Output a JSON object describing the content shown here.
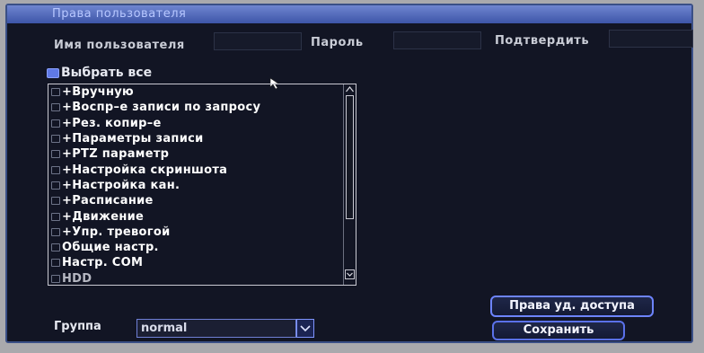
{
  "window": {
    "title": "Права пользователя"
  },
  "form": {
    "username_label": "Имя пользователя",
    "username_value": "",
    "password_label": "Пароль",
    "password_value": "",
    "confirm_label": "Подтвердить",
    "confirm_value": ""
  },
  "select_all": {
    "label": "Выбрать все",
    "checked": true
  },
  "permissions": {
    "items": [
      {
        "label": "+Вручную",
        "checked": false
      },
      {
        "label": "+Воспр–е записи по запросу",
        "checked": false
      },
      {
        "label": "+Рез. копир–е",
        "checked": false
      },
      {
        "label": "+Параметры записи",
        "checked": false
      },
      {
        "label": "+PTZ параметр",
        "checked": false
      },
      {
        "label": "+Настройка скриншота",
        "checked": false
      },
      {
        "label": "+Настройка кан.",
        "checked": false
      },
      {
        "label": "+Расписание",
        "checked": false
      },
      {
        "label": "+Движение",
        "checked": false
      },
      {
        "label": "+Упр. тревогой",
        "checked": false
      },
      {
        "label": "Общие настр.",
        "checked": false
      },
      {
        "label": "Настр. COM",
        "checked": false
      },
      {
        "label": "HDD",
        "checked": false
      }
    ]
  },
  "group": {
    "label": "Группа",
    "value": "normal"
  },
  "buttons": {
    "remote_rights": "Права уд. доступа",
    "save": "Сохранить"
  },
  "colors": {
    "panel_bg": "#121524",
    "title_bar": "#5a70c4",
    "accent": "#6d84ff"
  }
}
